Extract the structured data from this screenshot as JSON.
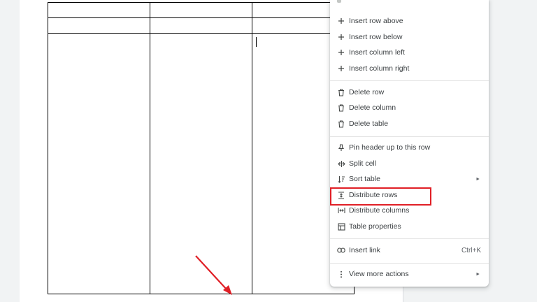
{
  "context_menu": {
    "items": [
      {
        "label": "Insert row above",
        "icon": "plus-icon"
      },
      {
        "label": "Insert row below",
        "icon": "plus-icon"
      },
      {
        "label": "Insert column left",
        "icon": "plus-icon"
      },
      {
        "label": "Insert column right",
        "icon": "plus-icon"
      },
      {
        "label": "Delete row",
        "icon": "trash-icon"
      },
      {
        "label": "Delete column",
        "icon": "trash-icon"
      },
      {
        "label": "Delete table",
        "icon": "trash-icon"
      },
      {
        "label": "Pin header up to this row",
        "icon": "pin-icon"
      },
      {
        "label": "Split cell",
        "icon": "split-cell-icon"
      },
      {
        "label": "Sort table",
        "icon": "sort-icon",
        "has_submenu": true
      },
      {
        "label": "Distribute rows",
        "icon": "distribute-rows-icon",
        "highlighted": true
      },
      {
        "label": "Distribute columns",
        "icon": "distribute-columns-icon"
      },
      {
        "label": "Table properties",
        "icon": "table-icon"
      },
      {
        "label": "Insert link",
        "icon": "link-icon",
        "shortcut": "Ctrl+K"
      },
      {
        "label": "View more actions",
        "icon": "more-vert-icon",
        "has_submenu": true
      }
    ],
    "submenu_arrow": "►"
  },
  "document": {
    "table": {
      "rows": 3,
      "columns": 3
    }
  },
  "annotation": {
    "highlight_color": "#e01f26",
    "highlighted_item": "Distribute rows"
  }
}
